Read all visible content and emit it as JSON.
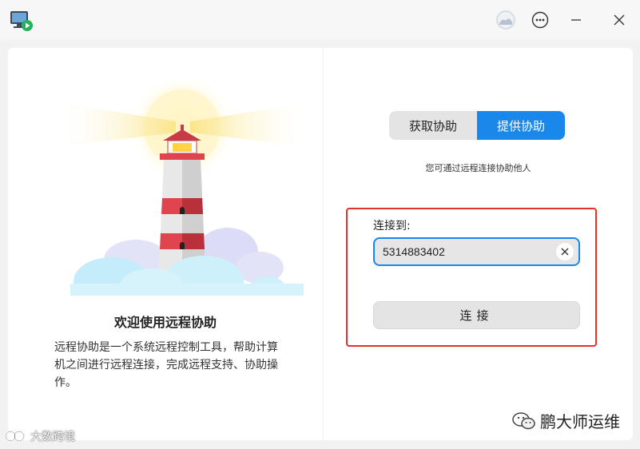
{
  "titlebar": {
    "icons": [
      "remote-assist-app-icon",
      "user-avatar-icon",
      "more-options-icon",
      "minimize-icon",
      "close-icon"
    ]
  },
  "left": {
    "title": "欢迎使用远程协助",
    "description": "远程协助是一个系统远程控制工具，帮助计算机之间进行远程连接，完成远程支持、协助操作。"
  },
  "right": {
    "tabs": [
      {
        "label": "获取协助",
        "active": false
      },
      {
        "label": "提供协助",
        "active": true
      }
    ],
    "hint": "您可通过远程连接协助他人",
    "connect_label": "连接到:",
    "id_value": "5314883402",
    "connect_button": "连接"
  },
  "watermarks": {
    "right": "鹏大师运维",
    "left": "大数跨境"
  },
  "colors": {
    "accent": "#1a88ea",
    "highlight_box": "#e8302a",
    "panel_bg": "#ffffff",
    "window_bg": "#f2f2f2"
  }
}
